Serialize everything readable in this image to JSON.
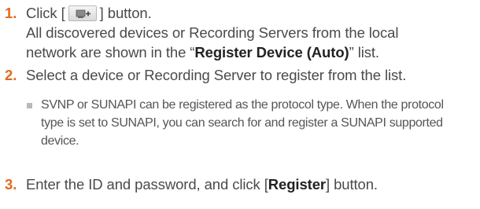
{
  "steps": [
    {
      "number": "1.",
      "text_before": "Click [",
      "button_icon": "add-device-icon",
      "text_after": "] button.",
      "description_line1": "All discovered devices or Recording Servers from the local",
      "description_line2_before": "network are shown in the “",
      "description_line2_bold": "Register Device (Auto)",
      "description_line2_after": "” list."
    },
    {
      "number": "2.",
      "text": "Select a device or Recording Server to register from the list."
    },
    {
      "number": "3.",
      "text_before": "Enter the ID and password, and click [",
      "text_bold": "Register",
      "text_after": "] button."
    }
  ],
  "note": {
    "text": "SVNP or SUNAPI can be registered as the protocol type. When the protocol type is set to SUNAPI, you can search for and register a SUNAPI supported device."
  },
  "colors": {
    "step_number": "#e06a1c",
    "body_text": "#4a4a4a",
    "bold_text": "#222222",
    "bullet": "#b9b9b9"
  }
}
